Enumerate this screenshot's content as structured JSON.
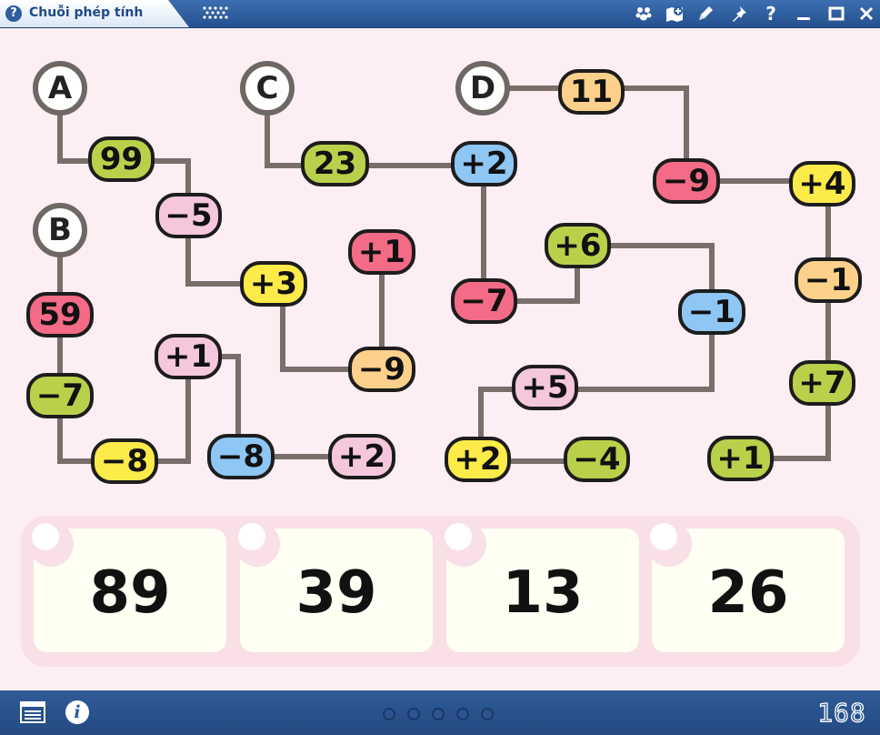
{
  "window": {
    "title": "Chuỗi phép tính"
  },
  "colors": {
    "green": "#b9d14a",
    "yellow": "#fdeb4a",
    "pink": "#f5c7dd",
    "red": "#f36b86",
    "blue": "#8ec6f4",
    "orange": "#fdd18b"
  },
  "start_labels": {
    "a": "A",
    "b": "B",
    "c": "C",
    "d": "D"
  },
  "chains": {
    "a": [
      "99",
      "−5",
      "+3",
      "−9",
      "+1"
    ],
    "b": [
      "59",
      "−7",
      "−8",
      "+1",
      "−8",
      "+2"
    ],
    "c": [
      "23",
      "+2",
      "−7",
      "+6",
      "−1",
      "+5",
      "+2",
      "−4"
    ],
    "d": [
      "11",
      "−9",
      "+4",
      "−1",
      "+7",
      "+1"
    ]
  },
  "answers": [
    "89",
    "39",
    "13",
    "26"
  ],
  "toolbar_icons": [
    "paw-icon",
    "map-plus-icon",
    "pencil-icon",
    "pin-icon",
    "help-icon",
    "minimize-icon",
    "maximize-icon",
    "close-icon"
  ],
  "footer": {
    "page_count": 5,
    "counter": "168"
  }
}
